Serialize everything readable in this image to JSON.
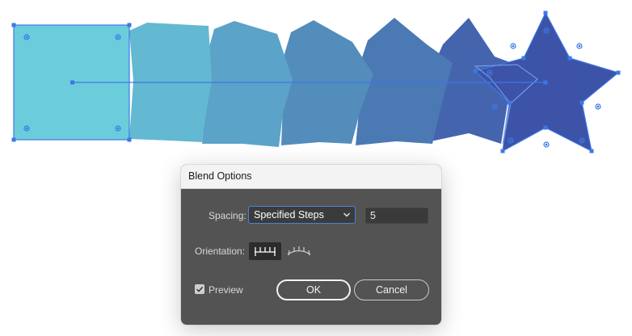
{
  "canvas": {
    "background": "#ffffff",
    "selection_color": "#3c78e6",
    "shapes": [
      {
        "name": "start-square",
        "color": "#6bccdc"
      },
      {
        "name": "blend-step-1",
        "color": "#63b8d2"
      },
      {
        "name": "blend-step-2",
        "color": "#5ba3c8"
      },
      {
        "name": "blend-step-3",
        "color": "#528dbc"
      },
      {
        "name": "blend-step-4",
        "color": "#4a79b4"
      },
      {
        "name": "blend-step-5",
        "color": "#4465ae"
      },
      {
        "name": "end-star",
        "color": "#3d53a8"
      }
    ]
  },
  "dialog": {
    "title": "Blend Options",
    "spacing": {
      "label": "Spacing:",
      "selected": "Specified Steps",
      "chevron_icon": "chevron-down-icon",
      "steps_value": "5"
    },
    "orientation": {
      "label": "Orientation:",
      "options": [
        {
          "icon": "align-to-page-icon",
          "active": true
        },
        {
          "icon": "align-to-path-icon",
          "active": false
        }
      ]
    },
    "preview": {
      "label": "Preview",
      "checked": true
    },
    "ok_label": "OK",
    "cancel_label": "Cancel"
  }
}
